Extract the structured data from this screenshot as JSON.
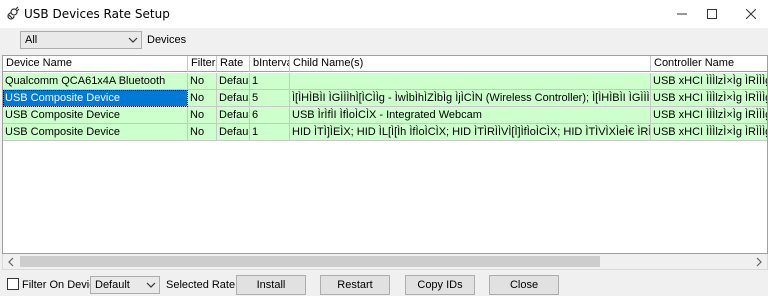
{
  "window": {
    "title": "USB Devices Rate Setup",
    "app_icon": "plug-icon",
    "controls": [
      "minimize-icon",
      "maximize-icon",
      "close-icon"
    ]
  },
  "filter": {
    "device_filter_value": "All",
    "devices_label": "Devices"
  },
  "table": {
    "columns": [
      "Device Name",
      "Filter?",
      "Rate",
      "bInterval",
      "Child Name(s)",
      "Controller Name"
    ],
    "rows": [
      {
        "device": "Qualcomm QCA61x4A Bluetooth",
        "filter": "No",
        "rate": "Default",
        "binterval": "1",
        "child": "",
        "controller": "USB xHCI ÌÌÌlzÌ×Ìg ÌRÌÌÌgÌ[Ì(-A",
        "selected": false
      },
      {
        "device": "USB Composite Device",
        "filter": "No",
        "rate": "Default",
        "binterval": "5",
        "child": "Ì[ÌHÌBÌI ÌGÌÌÌhÌ[ÌCÌÌg - ÌwÌbÌhÌZÌbÌg ÌjÌCÌN (Wireless Controller); Ì[ÌHÌBÌI ÌGÌÌÌhÌ[ÌCÌÌg - ÌwÌbÌhÌZÌbÌ",
        "controller": "USB xHCI ÌÌÌlzÌ×Ìg ÌRÌÌÌgÌ[Ì(-A",
        "selected": true
      },
      {
        "device": "USB Composite Device",
        "filter": "No",
        "rate": "Default",
        "binterval": "6",
        "child": "USB ÌrÌfÌI ÌfÌoÌCÌX - Integrated Webcam",
        "controller": "USB xHCI ÌÌÌlzÌ×Ìg ÌRÌÌÌgÌ[Ì(-A",
        "selected": false
      },
      {
        "device": "USB Composite Device",
        "filter": "No",
        "rate": "Default",
        "binterval": "1",
        "child": "HID ÌTÌ]ÌEÌX; HID ÌL[Ì[Ìh ÌfÌoÌCÌX; HID ÌTÌRÌÌVÌ[Ì]ÌfÌoÌCÌX; HID ÌTÌVÌXÌeÌ€ ÌRÌÌgÌ[Ì[; HID ÌTÌ",
        "controller": "USB xHCI ÌÌÌlzÌ×Ìg ÌRÌÌÌgÌ[Ì(-A",
        "selected": false
      }
    ]
  },
  "scrollbar": {
    "left_icon": "chevron-left-icon",
    "right_icon": "chevron-right-icon"
  },
  "bottom": {
    "filter_on_device_label": "Filter On Device",
    "filter_on_device_checked": false,
    "rate_value": "Default",
    "selected_rate_label": "Selected Rate",
    "install_service": "Install Service",
    "restart": "Restart",
    "copy_ids": "Copy IDs",
    "close": "Close"
  },
  "colors": {
    "row_background": "#ccffcc",
    "selection": "#0078d7"
  }
}
